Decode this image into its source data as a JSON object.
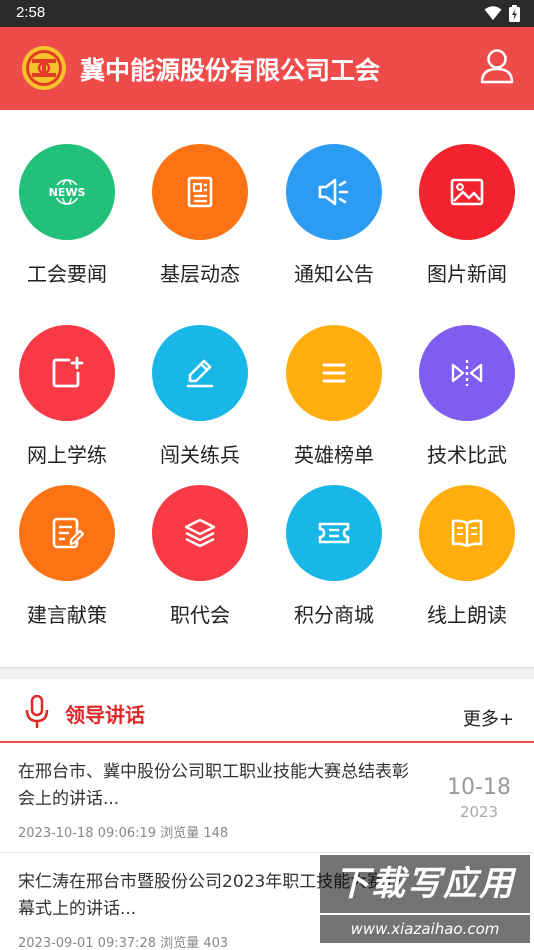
{
  "status_bar": {
    "time": "2:58",
    "wifi_icon": "wifi-icon",
    "battery_icon": "battery-charging-icon"
  },
  "app_bar": {
    "title": "冀中能源股份有限公司工会",
    "background": "#ef4b4b",
    "logo_icon": "union-logo-icon",
    "user_icon": "user-icon"
  },
  "menu": {
    "items": [
      {
        "label": "工会要闻",
        "icon": "news-icon",
        "color": "#22c17a"
      },
      {
        "label": "基层动态",
        "icon": "document-icon",
        "color": "#fb7314"
      },
      {
        "label": "通知公告",
        "icon": "speaker-icon",
        "color": "#2c9cf3"
      },
      {
        "label": "图片新闻",
        "icon": "image-icon",
        "color": "#f2222e"
      },
      {
        "label": "网上学练",
        "icon": "add-note-icon",
        "color": "#f73a46"
      },
      {
        "label": "闯关练兵",
        "icon": "pencil-icon",
        "color": "#19b6e8"
      },
      {
        "label": "英雄榜单",
        "icon": "list-icon",
        "color": "#ffae0d"
      },
      {
        "label": "技术比武",
        "icon": "versus-icon",
        "color": "#7f5df0"
      },
      {
        "label": "建言献策",
        "icon": "edit-note-icon",
        "color": "#fb7314"
      },
      {
        "label": "职代会",
        "icon": "layers-icon",
        "color": "#f73a46"
      },
      {
        "label": "积分商城",
        "icon": "ticket-icon",
        "color": "#19b6e8"
      },
      {
        "label": "线上朗读",
        "icon": "book-icon",
        "color": "#ffae0d"
      }
    ]
  },
  "section": {
    "title": "领导讲话",
    "more": "更多+",
    "icon": "microphone-icon",
    "accent": "#e02828"
  },
  "news": [
    {
      "title_line1": "在邢台市、冀中股份公司职工职业技能大赛总结表彰",
      "title_line2": "会上的讲话...",
      "datetime": "2023-10-18 09:06:19",
      "views_label": "浏览量",
      "views": "148",
      "date_md": "10-18",
      "date_y": "2023"
    },
    {
      "title_line1": "宋仁涛在邢台市暨股份公司2023年职工技能大赛开",
      "title_line2": "幕式上的讲话...",
      "datetime": "2023-09-01 09:37:28",
      "views_label": "浏览量",
      "views": "403",
      "date_md": "",
      "date_y": ""
    }
  ],
  "watermark": {
    "main": "下载写应用",
    "url": "www.xiazaihao.com"
  }
}
